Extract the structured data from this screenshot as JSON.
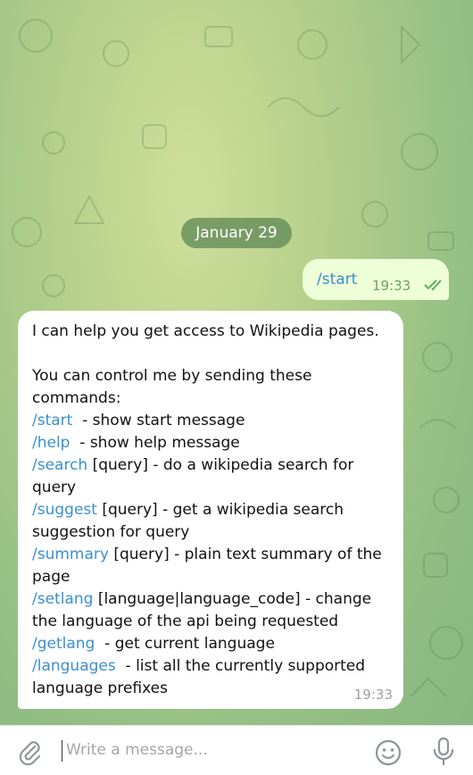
{
  "date_separator": "January 29",
  "outgoing_message": {
    "text": "/start",
    "time": "19:33",
    "status_icon": "double-check-icon"
  },
  "incoming_message": {
    "intro": "I can help you get access to Wikipedia pages.",
    "control_line": "You can control me by sending these commands:",
    "commands": [
      {
        "cmd": "/start",
        "desc": "  - show start message"
      },
      {
        "cmd": "/help",
        "desc": "  - show help message"
      },
      {
        "cmd": "/search",
        "desc": " [query] - do a wikipedia search for query"
      },
      {
        "cmd": "/suggest",
        "desc": " [query] - get a wikipedia search suggestion for query"
      },
      {
        "cmd": "/summary",
        "desc": " [query] - plain text summary of the page"
      },
      {
        "cmd": "/setlang",
        "desc": " [language|language_code] - change the language of the api being requested"
      },
      {
        "cmd": "/getlang",
        "desc": "  - get current language"
      },
      {
        "cmd": "/languages",
        "desc": "  - list all the currently supported language prefixes"
      }
    ],
    "time": "19:33"
  },
  "composer": {
    "placeholder": "Write a message...",
    "attach_icon": "paperclip-icon",
    "emoji_icon": "emoji-icon",
    "mic_icon": "microphone-icon"
  },
  "colors": {
    "link": "#3a8fd0",
    "outgoing_bubble": "#eefed7",
    "incoming_bubble": "#ffffff",
    "wallpaper": "#a8c98a",
    "date_pill": "#5f8755"
  }
}
